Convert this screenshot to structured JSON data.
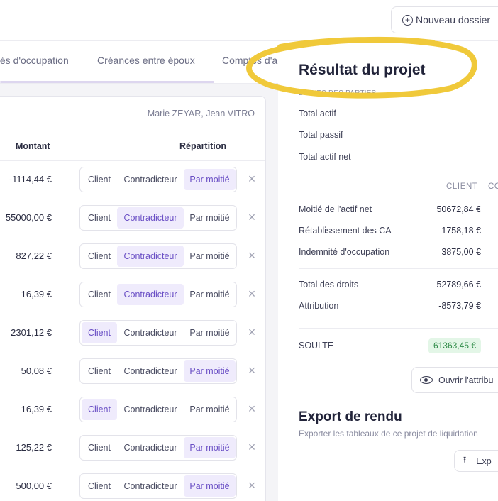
{
  "header": {
    "new_file_label": "Nouveau dossier",
    "new_file_icon": "plus-circle-icon"
  },
  "tabs": [
    "tés d'occupation",
    "Créances entre époux",
    "Comptes d'a"
  ],
  "table": {
    "parties": "Marie ZEYAR, Jean VITRO",
    "col_amount": "Montant",
    "col_split": "Répartition",
    "options": {
      "client": "Client",
      "contra": "Contradicteur",
      "moitie": "Par moitié"
    },
    "rows": [
      {
        "amount": "-1114,44 €",
        "selected": "moitie"
      },
      {
        "amount": "55000,00 €",
        "selected": "contra"
      },
      {
        "amount": "827,22 €",
        "selected": "contra"
      },
      {
        "amount": "16,39 €",
        "selected": "contra"
      },
      {
        "amount": "2301,12 €",
        "selected": "client"
      },
      {
        "amount": "50,08 €",
        "selected": "moitie"
      },
      {
        "amount": "16,39 €",
        "selected": "client"
      },
      {
        "amount": "125,22 €",
        "selected": "moitie"
      },
      {
        "amount": "500,00 €",
        "selected": "moitie"
      }
    ]
  },
  "result": {
    "title": "Résultat du projet",
    "section_label": "DROITS DES PARTIES",
    "total_actif": "Total actif",
    "total_passif": "Total passif",
    "total_actif_net": "Total actif net",
    "col_client": "CLIENT",
    "col_contra": "CO",
    "lines1": [
      {
        "label": "Moitié de l'actif net",
        "client": "50672,84 €"
      },
      {
        "label": "Rétablissement des CA",
        "client": "-1758,18 €"
      },
      {
        "label": "Indemnité d'occupation",
        "client": "3875,00 €"
      }
    ],
    "lines2": [
      {
        "label": "Total des droits",
        "client": "52789,66 €"
      },
      {
        "label": "Attribution",
        "client": "-8573,79 €"
      }
    ],
    "soulte_label": "SOULTE",
    "soulte_value": "61363,45 €",
    "open_button": "Ouvrir l'attribu"
  },
  "export": {
    "title": "Export de rendu",
    "subtitle": "Exporter les tableaux de ce projet de liquidation",
    "button": "Exp"
  },
  "colors": {
    "accent": "#6a4fc5",
    "selected_bg": "#efebfc",
    "highlight": "#f0c93a",
    "soulte_bg": "#e3f6e7",
    "soulte_fg": "#2e8a47"
  }
}
